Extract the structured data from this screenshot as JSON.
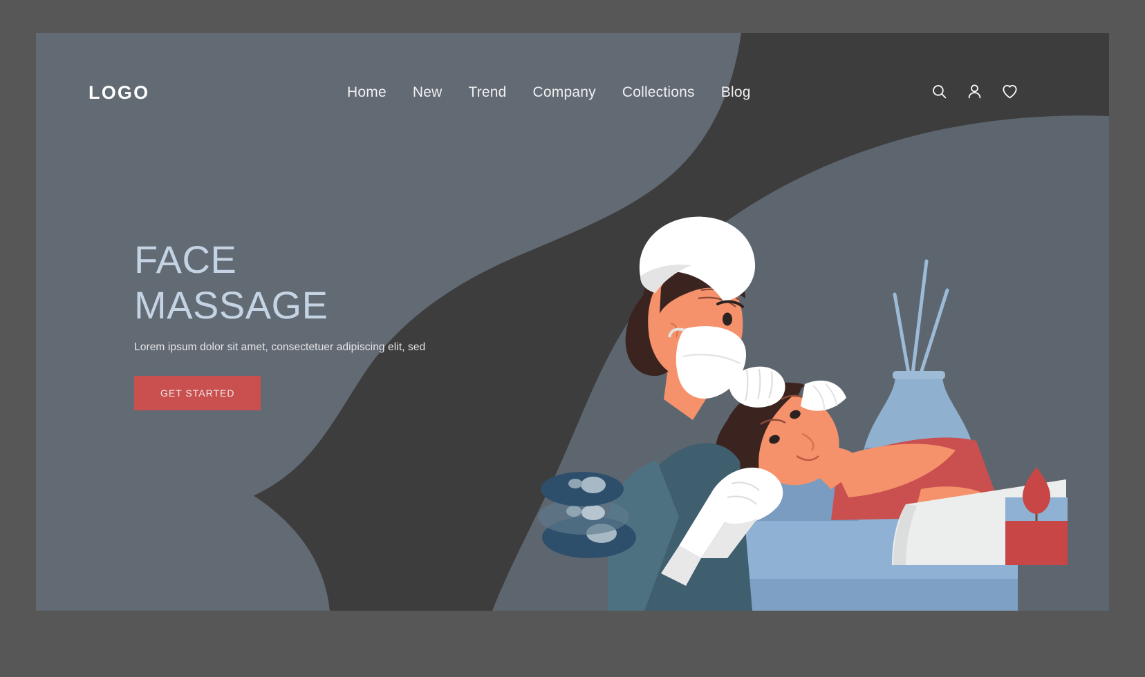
{
  "page": {
    "title": "FACE MASSAGE spa landing page",
    "frame_color": "#575757",
    "hero_bg": "#3d3d3d",
    "blob_color": "#626a74"
  },
  "nav": {
    "logo": "LOGO",
    "links": [
      {
        "label": "Home"
      },
      {
        "label": "New"
      },
      {
        "label": "Trend"
      },
      {
        "label": "Company"
      },
      {
        "label": "Collections"
      },
      {
        "label": "Blog"
      }
    ],
    "icons": [
      {
        "name": "search-icon"
      },
      {
        "name": "user-icon"
      },
      {
        "name": "heart-icon"
      }
    ],
    "link_color": "#f0f0f0",
    "logo_color": "#ffffff"
  },
  "hero": {
    "headline": "FACE\nMASSAGE",
    "headline_color": "#c5d4e4",
    "subhead": "Lorem ipsum dolor sit amet, consectetuer adipiscing elit, sed",
    "subhead_color": "#e6e6e6",
    "cta_label": "GET STARTED",
    "cta_bg": "#c9504f",
    "cta_text_color": "#f2e9e6"
  },
  "illustration": {
    "name": "face-massage-scene",
    "elements": [
      {
        "name": "therapist-figure",
        "description": "masked beautician with white cap and teal uniform"
      },
      {
        "name": "client-figure",
        "description": "woman lying on massage bed receiving facial"
      },
      {
        "name": "gloved-hands",
        "description": "white gloved hands on client face"
      },
      {
        "name": "spa-stones",
        "description": "stacked dark blue massage stones"
      },
      {
        "name": "reed-diffuser-vase",
        "description": "blue glass vase with reed sticks"
      },
      {
        "name": "towel",
        "description": "folded white towel"
      },
      {
        "name": "candle",
        "description": "red candle in blue glass holder"
      }
    ],
    "colors": {
      "skin": "#f5926b",
      "uniform": "#3f5e6e",
      "hair": "#3b2420",
      "white": "#ffffff",
      "bed": "#8fb2d4",
      "bed_shadow": "#6e90b5",
      "client_top": "#c9504f",
      "vase": "#7ea3c6",
      "candle_wax": "#c94646",
      "candle_glass": "#8fb2d4",
      "stone_dark": "#2e4f6b",
      "stone_light": "#a8b9c6",
      "backdrop": "#5d666f"
    }
  }
}
